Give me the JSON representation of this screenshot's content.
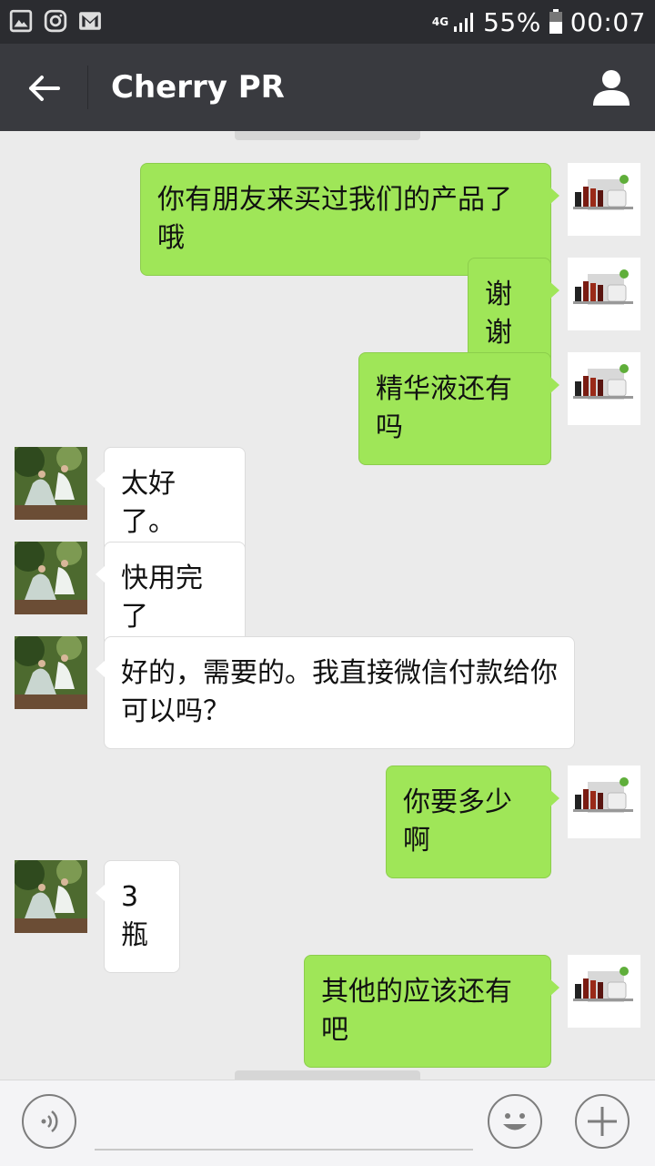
{
  "status_bar": {
    "battery": "55%",
    "time": "00:07",
    "network": "4G",
    "left_icons": [
      "gallery-icon",
      "instagram-icon",
      "gmail-icon"
    ]
  },
  "header": {
    "title": "Cherry PR"
  },
  "messages": [
    {
      "side": "me",
      "text": "你有朋友来买过我们的产品了哦"
    },
    {
      "side": "me",
      "text": "谢谢"
    },
    {
      "side": "me",
      "text": "精华液还有吗"
    },
    {
      "side": "them",
      "text": "太好了。"
    },
    {
      "side": "them",
      "text": "快用完了"
    },
    {
      "side": "them",
      "text": "好的，需要的。我直接微信付款给你可以吗？"
    },
    {
      "side": "me",
      "text": "你要多少啊"
    },
    {
      "side": "them",
      "text": "3瓶"
    },
    {
      "side": "me",
      "text": "其他的应该还有吧"
    }
  ],
  "colors": {
    "sent_bubble": "#9fe658",
    "received_bubble": "#ffffff",
    "chat_background": "#ebebeb",
    "header_background": "#393a3f",
    "statusbar_background": "#2b2c30"
  }
}
